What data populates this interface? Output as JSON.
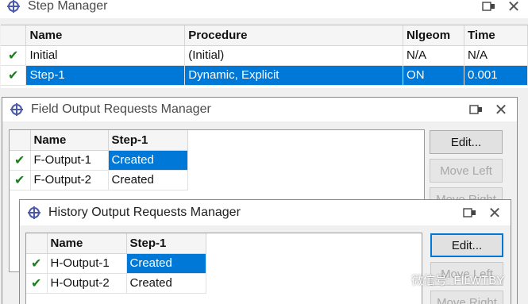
{
  "step_manager": {
    "title": "Step Manager",
    "columns": [
      "Name",
      "Procedure",
      "Nlgeom",
      "Time"
    ],
    "rows": [
      {
        "check": "✔",
        "name": "Initial",
        "procedure": "(Initial)",
        "nlgeom": "N/A",
        "time": "N/A",
        "selected": false
      },
      {
        "check": "✔",
        "name": "Step-1",
        "procedure": "Dynamic, Explicit",
        "nlgeom": "ON",
        "time": "0.001",
        "selected": true
      }
    ],
    "partial_label": "St"
  },
  "field_output_manager": {
    "title": "Field Output Requests Manager",
    "columns": [
      "Name",
      "Step-1"
    ],
    "rows": [
      {
        "check": "✔",
        "name": "F-Output-1",
        "status": "Created",
        "selected": true
      },
      {
        "check": "✔",
        "name": "F-Output-2",
        "status": "Created",
        "selected": false
      }
    ],
    "buttons": {
      "edit": "Edit...",
      "move_left": "Move Left",
      "move_right": "Move Right"
    }
  },
  "history_output_manager": {
    "title": "History Output Requests Manager",
    "columns": [
      "Name",
      "Step-1"
    ],
    "rows": [
      {
        "check": "✔",
        "name": "H-Output-1",
        "status": "Created",
        "selected": true
      },
      {
        "check": "✔",
        "name": "H-Output-2",
        "status": "Created",
        "selected": false
      }
    ],
    "buttons": {
      "edit": "Edit...",
      "move_left": "Move Left",
      "move_right": "Move Right"
    }
  },
  "watermark": {
    "text": "微信号: FILWTBY"
  },
  "colors": {
    "selection": "#0078d7",
    "check": "#1b7f1b",
    "window_bg": "#f0f0f0"
  },
  "icons": [
    "abaqus-manager-icon",
    "restore-window-icon",
    "close-icon",
    "check-icon",
    "wechat-icon"
  ]
}
